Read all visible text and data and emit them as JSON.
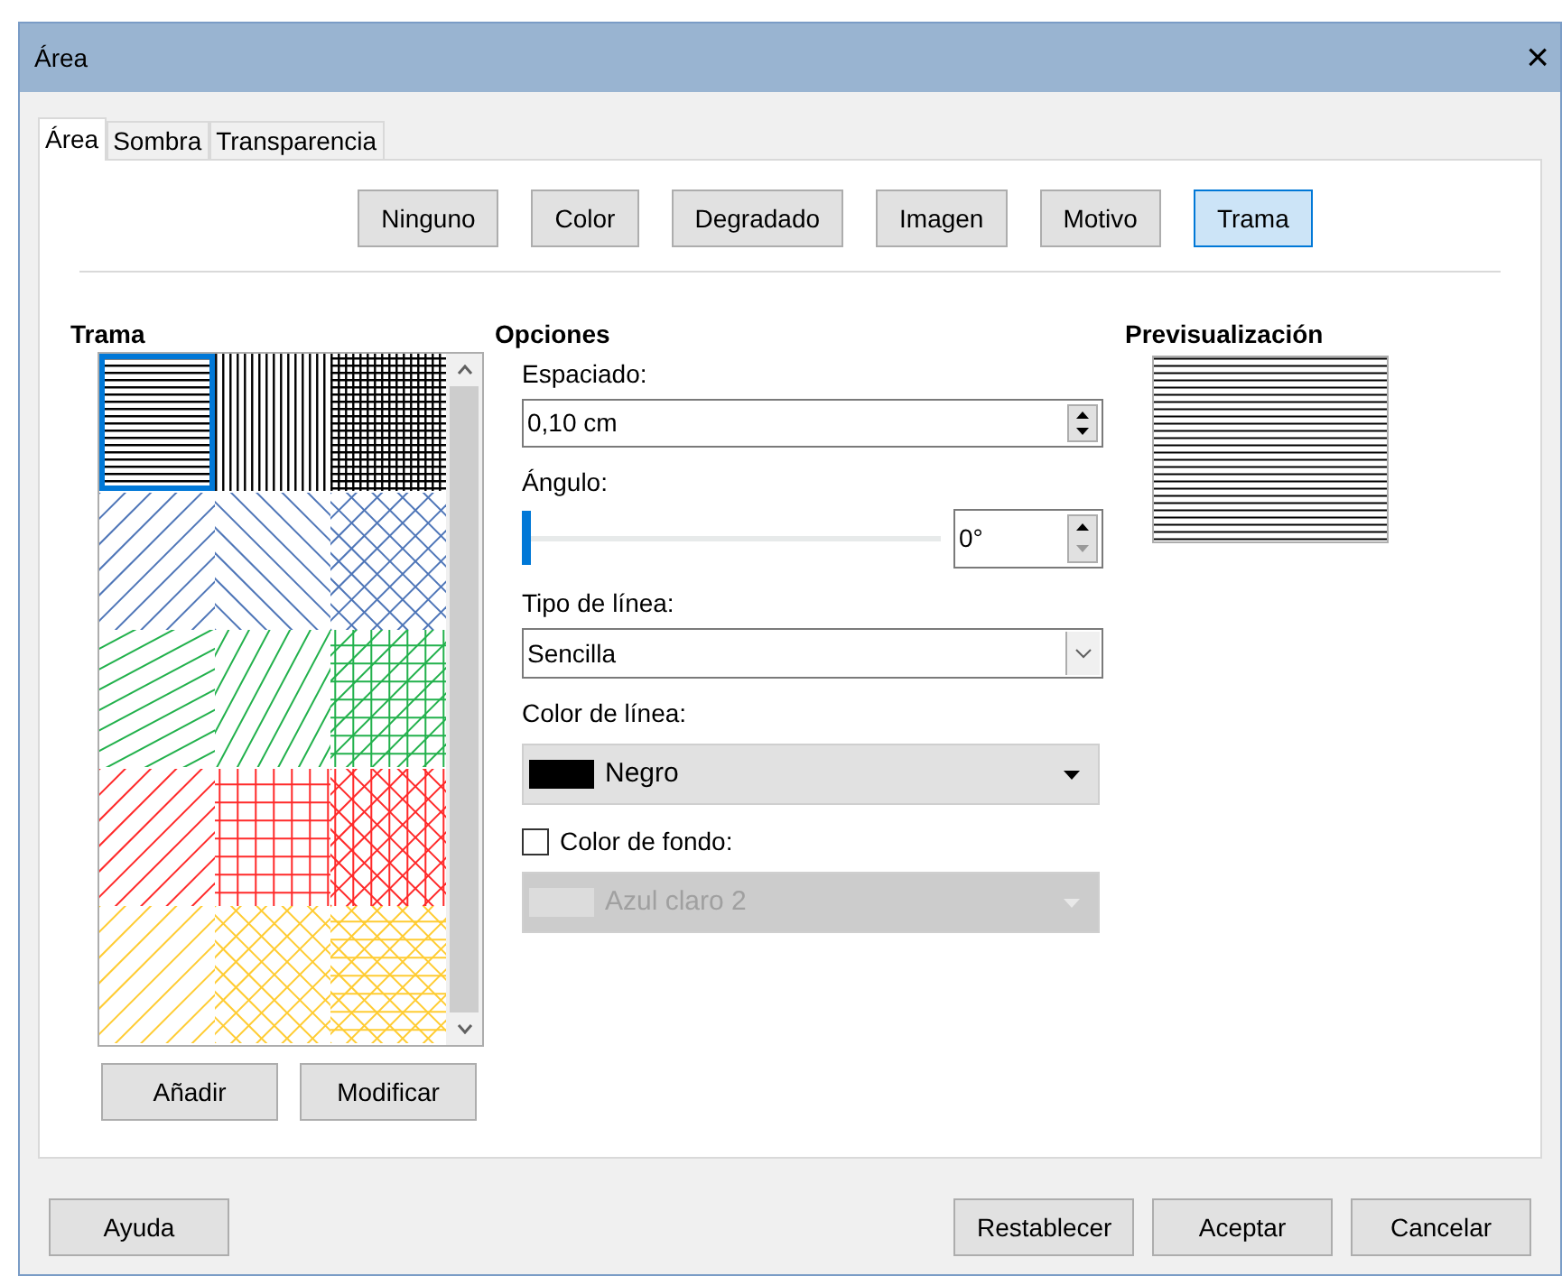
{
  "window": {
    "title": "Área",
    "close": "×"
  },
  "tabs": [
    {
      "label": "Área",
      "selected": true
    },
    {
      "label": "Sombra",
      "selected": false
    },
    {
      "label": "Transparencia",
      "selected": false
    }
  ],
  "fill_types": [
    {
      "label": "Ninguno",
      "selected": false
    },
    {
      "label": "Color",
      "selected": false
    },
    {
      "label": "Degradado",
      "selected": false
    },
    {
      "label": "Imagen",
      "selected": false
    },
    {
      "label": "Motivo",
      "selected": false
    },
    {
      "label": "Trama",
      "selected": true
    }
  ],
  "pattern_panel": {
    "title": "Trama",
    "patterns": [
      {
        "kind": "horizontal",
        "color": "#000000",
        "selected": true
      },
      {
        "kind": "vertical",
        "color": "#000000",
        "selected": false
      },
      {
        "kind": "grid",
        "color": "#000000",
        "selected": false
      },
      {
        "kind": "diagonal-up",
        "color": "#4f76b8",
        "selected": false
      },
      {
        "kind": "diagonal-down",
        "color": "#4f76b8",
        "selected": false
      },
      {
        "kind": "cross-diagonal",
        "color": "#4f76b8",
        "selected": false
      },
      {
        "kind": "low-diagonal",
        "color": "#22b14c",
        "selected": false
      },
      {
        "kind": "steep-diagonal",
        "color": "#22b14c",
        "selected": false
      },
      {
        "kind": "grid-diagonal",
        "color": "#22b14c",
        "selected": false
      },
      {
        "kind": "diagonal-up",
        "color": "#ff2a2a",
        "selected": false
      },
      {
        "kind": "grid",
        "color": "#ff2a2a",
        "selected": false
      },
      {
        "kind": "cross-vertical",
        "color": "#ff2a2a",
        "selected": false
      },
      {
        "kind": "diagonal-up",
        "color": "#ffcc33",
        "selected": false
      },
      {
        "kind": "cross-diagonal",
        "color": "#ffcc33",
        "selected": false
      },
      {
        "kind": "cross-horizontal",
        "color": "#ffcc33",
        "selected": false
      }
    ],
    "buttons": [
      "Añadir",
      "Modificar"
    ]
  },
  "options": {
    "title": "Opciones",
    "spacing": {
      "label": "Espaciado:",
      "value": "0,10 cm"
    },
    "angle": {
      "label": "Ángulo:",
      "level": 0,
      "value": "0°"
    },
    "line_type": {
      "label": "Tipo de línea:",
      "value": "Sencilla"
    },
    "line_color": {
      "label": "Color de línea:",
      "value": "Negro",
      "color": "#000000"
    },
    "background_color": {
      "label": "Color de fondo:",
      "checked": false,
      "value": "Azul claro 2",
      "disabled": true
    }
  },
  "preview": {
    "title": "Previsualización"
  },
  "help_button": "Ayuda",
  "buttons": [
    "Restablecer",
    "Aceptar",
    "Cancelar"
  ]
}
